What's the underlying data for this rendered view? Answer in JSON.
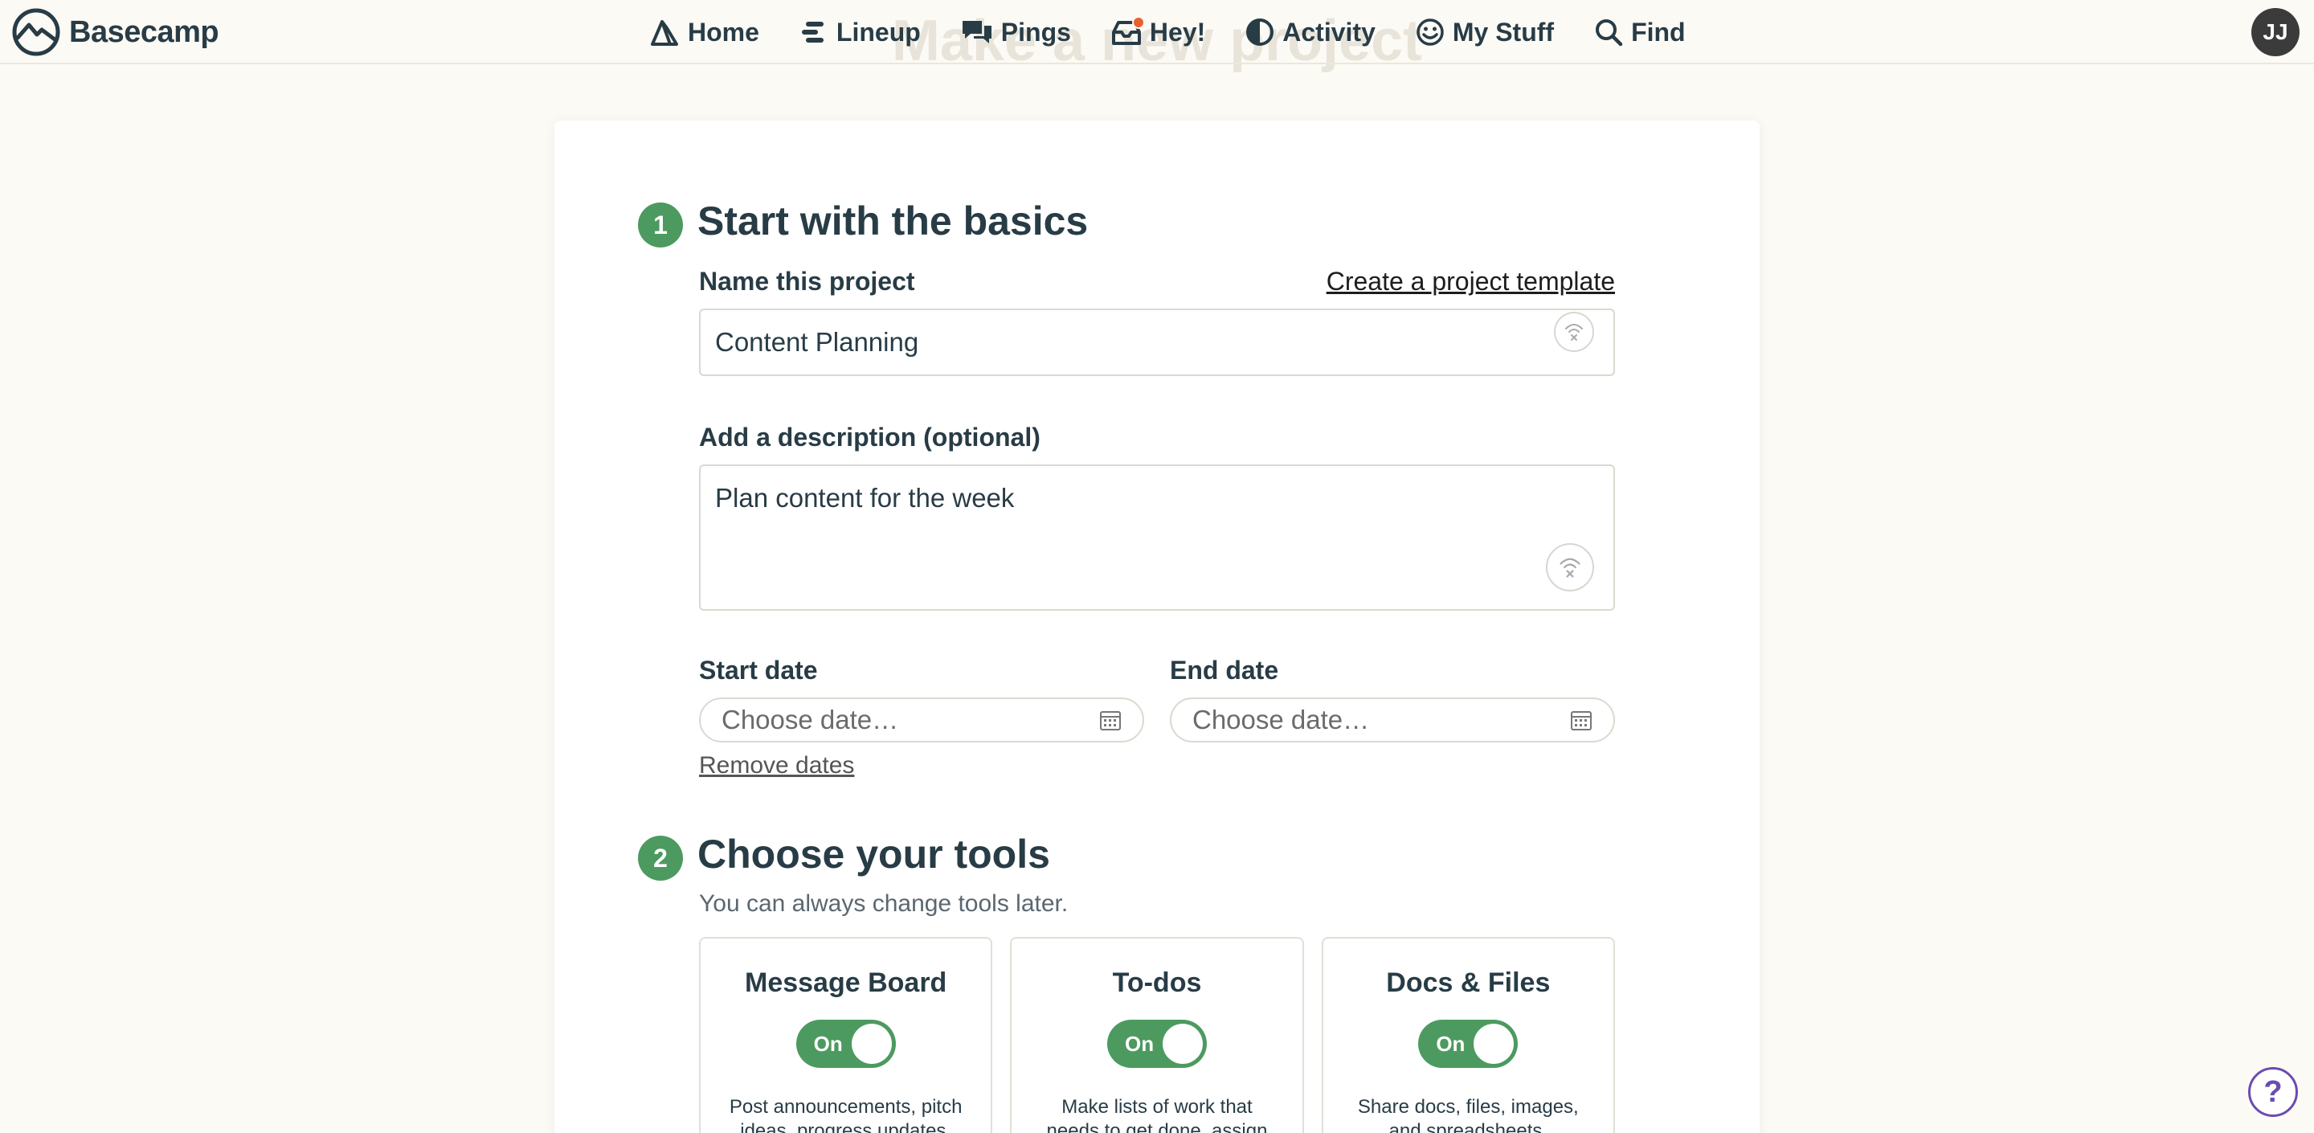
{
  "page": {
    "ghost_title": "Make a new project"
  },
  "nav": {
    "brand": "Basecamp",
    "items": [
      {
        "label": "Home",
        "icon": "home-icon"
      },
      {
        "label": "Lineup",
        "icon": "lineup-icon"
      },
      {
        "label": "Pings",
        "icon": "pings-icon"
      },
      {
        "label": "Hey!",
        "icon": "hey-icon"
      },
      {
        "label": "Activity",
        "icon": "activity-icon"
      },
      {
        "label": "My Stuff",
        "icon": "my-stuff-icon"
      },
      {
        "label": "Find",
        "icon": "find-icon"
      }
    ],
    "avatar_initials": "JJ",
    "notification_dot_color": "#e8612c"
  },
  "step1": {
    "number": "1",
    "heading": "Start with the basics",
    "name_label": "Name this project",
    "template_link": "Create a project template",
    "name_value": "Content Planning",
    "description_label": "Add a description (optional)",
    "description_value": "Plan content for the week",
    "start_date_label": "Start date",
    "end_date_label": "End date",
    "date_placeholder": "Choose date…",
    "remove_dates": "Remove dates"
  },
  "step2": {
    "number": "2",
    "heading": "Choose your tools",
    "subtext": "You can always change tools later.",
    "tools": [
      {
        "title": "Message Board",
        "toggle": "On",
        "description": "Post announcements, pitch ideas, progress updates,"
      },
      {
        "title": "To-dos",
        "toggle": "On",
        "description": "Make lists of work that needs to get done, assign"
      },
      {
        "title": "Docs & Files",
        "toggle": "On",
        "description": "Share docs, files, images, and spreadsheets."
      }
    ]
  },
  "help": {
    "label": "?"
  },
  "colors": {
    "accent_green": "#4c9a5f",
    "help_purple": "#6b4cb0",
    "background": "#fcfaf5"
  }
}
